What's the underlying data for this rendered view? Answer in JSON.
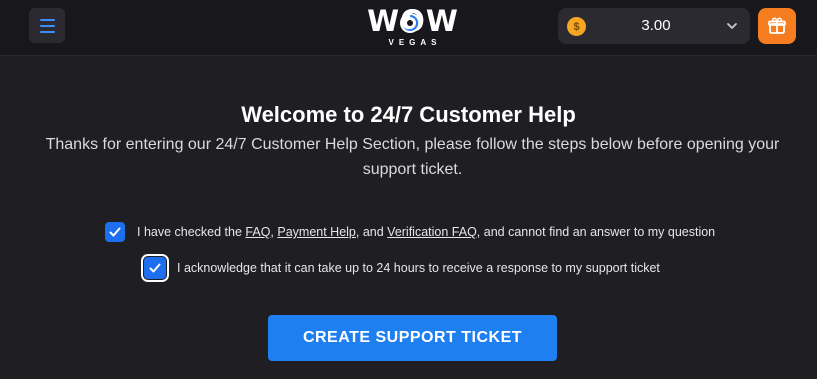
{
  "header": {
    "logo_text": "WOW",
    "logo_subtext": "VEGAS",
    "balance": {
      "coin_symbol": "$",
      "value": "3.00",
      "coin_color": "#f6a623"
    },
    "icons": {
      "menu": "hamburger-menu-icon",
      "dropdown": "chevron-down-icon",
      "gift": "gift-icon"
    },
    "accent_color": "#3f8cff",
    "gift_button_color": "#f57c1f"
  },
  "main": {
    "title": "Welcome to 24/7 Customer Help",
    "subtitle": "Thanks for entering our 24/7 Customer Help Section, please follow the steps below before opening your support ticket.",
    "checklist": [
      {
        "checked": true,
        "text_before": "I have checked the ",
        "link1": "FAQ",
        "sep1": ", ",
        "link2": "Payment Help",
        "sep2": ", and ",
        "link3": "Verification FAQ",
        "text_after": ", and cannot find an answer to my question"
      },
      {
        "checked": true,
        "text": "I acknowledge that it can take up to 24 hours to receive a response to my support ticket"
      }
    ],
    "cta_label": "CREATE SUPPORT TICKET",
    "cta_color": "#1e80f0"
  }
}
